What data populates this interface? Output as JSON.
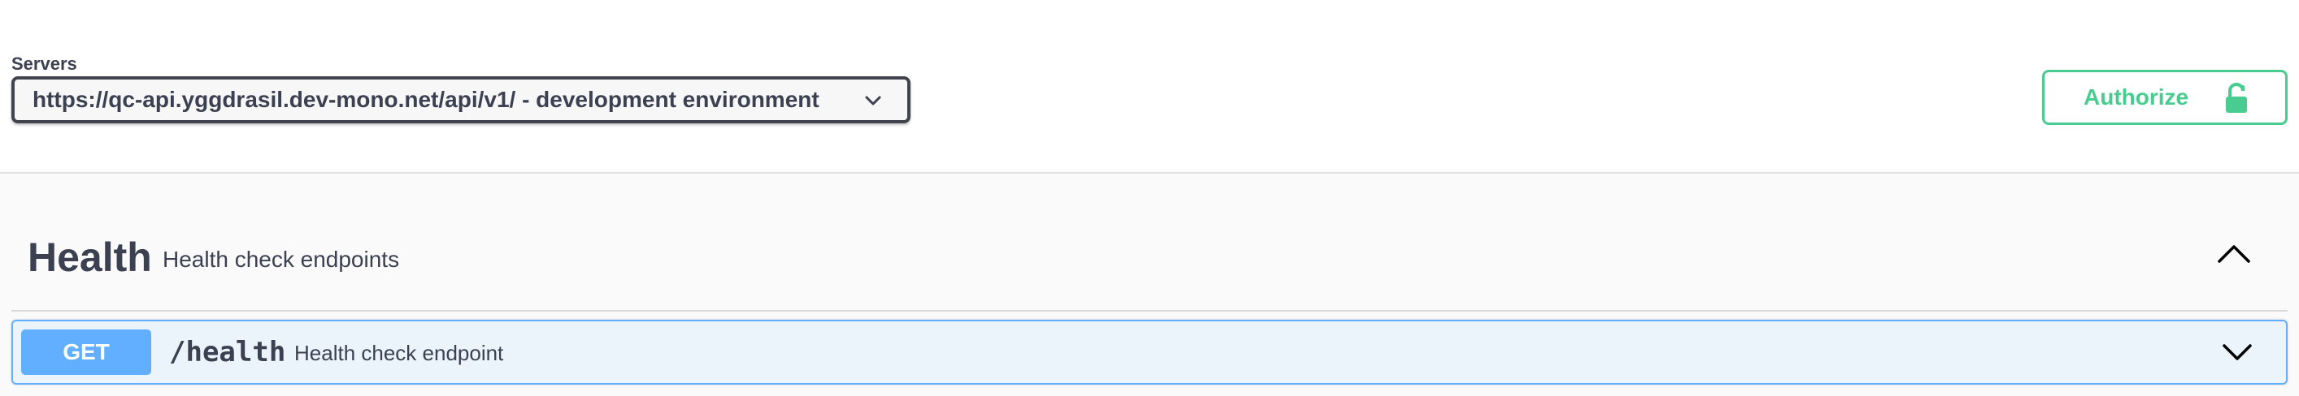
{
  "servers": {
    "label": "Servers",
    "selected": "https://qc-api.yggdrasil.dev-mono.net/api/v1/ - development environment",
    "chevron_icon": "chevron-down-icon"
  },
  "authorize": {
    "label": "Authorize",
    "icon": "unlock-icon",
    "color": "#49cc90"
  },
  "tag": {
    "name": "Health",
    "description": "Health check endpoints",
    "toggle_icon": "chevron-up-icon"
  },
  "operations": [
    {
      "method": "GET",
      "path": "/health",
      "summary": "Health check endpoint",
      "method_color": "#61affe",
      "toggle_icon": "chevron-down-icon"
    }
  ]
}
